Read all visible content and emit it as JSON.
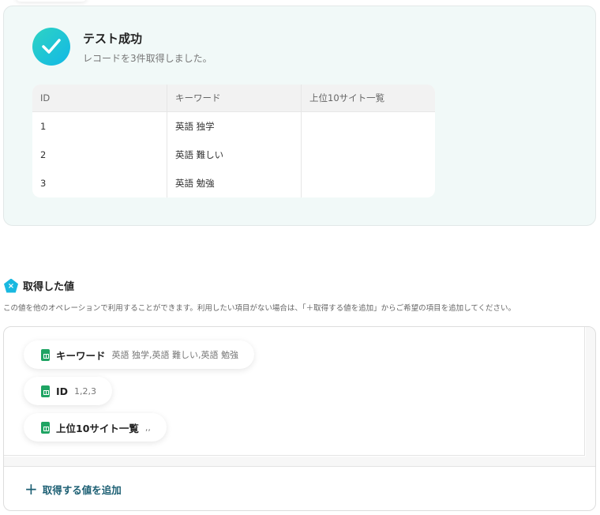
{
  "result": {
    "title": "テスト成功",
    "message": "レコードを3件取得しました。",
    "columns": [
      "ID",
      "キーワード",
      "上位10サイト一覧"
    ],
    "rows": [
      [
        "1",
        "英語 独学",
        ""
      ],
      [
        "2",
        "英語 難しい",
        ""
      ],
      [
        "3",
        "英語 勉強",
        ""
      ]
    ]
  },
  "values": {
    "heading": "取得した値",
    "description": "この値を他のオペレーションで利用することができます。利用したい項目がない場合は、「＋取得する値を追加」からご希望の項目を追加してください。",
    "items": [
      {
        "key": "キーワード",
        "value": "英語 独学,英語 難しい,英語 勉強"
      },
      {
        "key": "ID",
        "value": "1,2,3"
      },
      {
        "key": "上位10サイト一覧",
        "value": ",,"
      }
    ],
    "add_label": "取得する値を追加"
  },
  "colors": {
    "accent": "#12b8e6",
    "sheet": "#1fa463",
    "link": "#1c5f73"
  }
}
